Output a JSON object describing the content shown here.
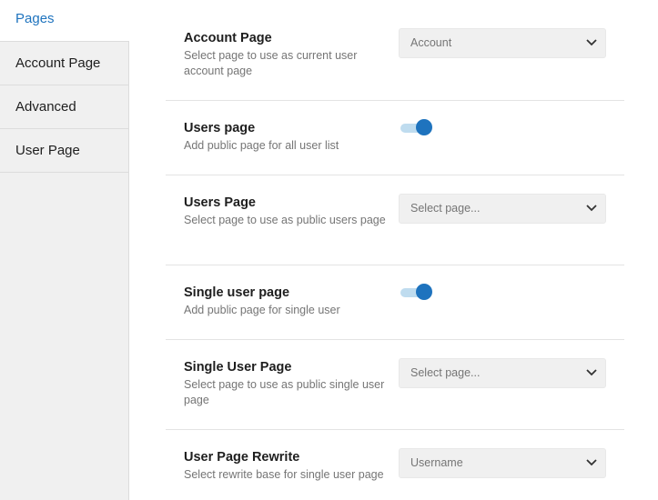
{
  "sidebar": {
    "tabs": [
      {
        "label": "Pages",
        "active": true
      },
      {
        "label": "Account Page",
        "active": false
      },
      {
        "label": "Advanced",
        "active": false
      },
      {
        "label": "User Page",
        "active": false
      }
    ]
  },
  "settings": {
    "account_page": {
      "title": "Account Page",
      "description": "Select page to use as current user account page",
      "value": "Account"
    },
    "users_page_toggle": {
      "title": "Users page",
      "description": "Add public page for all user list",
      "enabled": true
    },
    "users_page_select": {
      "title": "Users Page",
      "description": "Select page to use as public users page",
      "placeholder": "Select page..."
    },
    "single_user_toggle": {
      "title": "Single user page",
      "description": "Add public page for single user",
      "enabled": true
    },
    "single_user_select": {
      "title": "Single User Page",
      "description": "Select page to use as public single user page",
      "placeholder": "Select page..."
    },
    "rewrite": {
      "title": "User Page Rewrite",
      "description": "Select rewrite base for single user page",
      "value": "Username"
    }
  },
  "colors": {
    "accent": "#1e73be",
    "toggle_track": "#bfdcef",
    "sidebar_bg": "#f0f0f0"
  }
}
